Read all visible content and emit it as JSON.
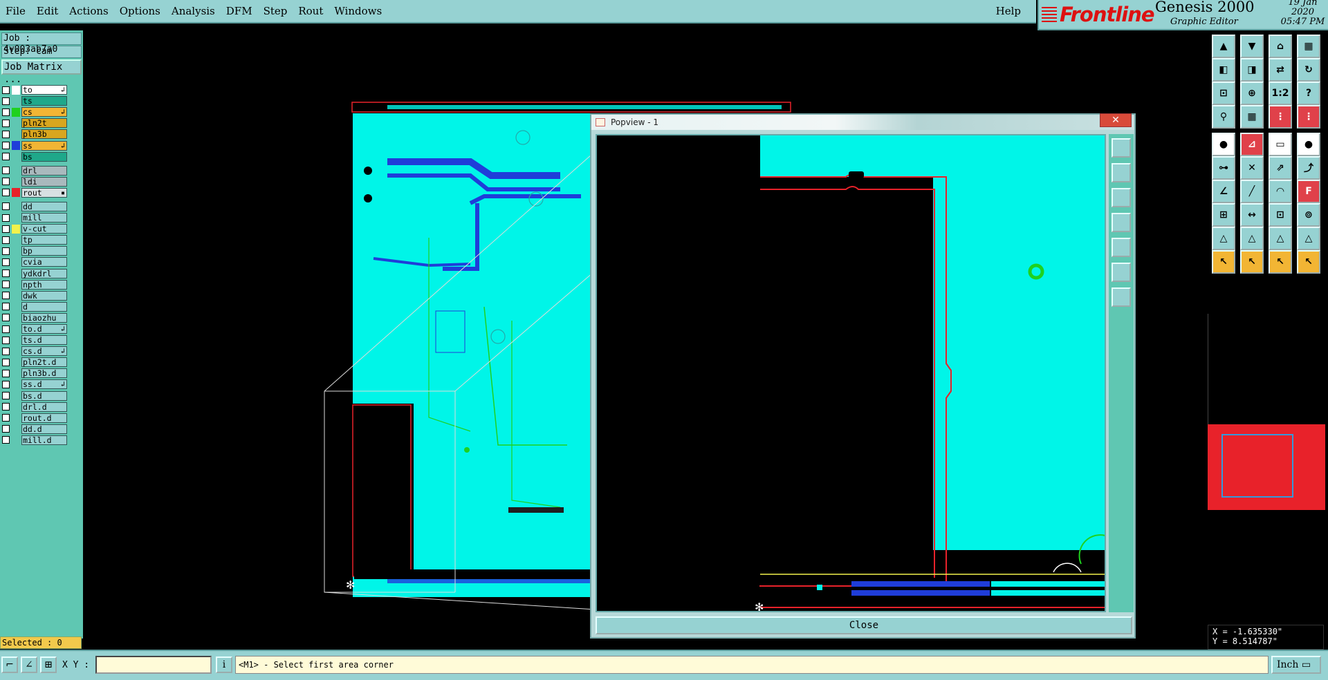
{
  "menu": {
    "items": [
      {
        "label": "File"
      },
      {
        "label": "Edit"
      },
      {
        "label": "Actions"
      },
      {
        "label": "Options"
      },
      {
        "label": "Analysis"
      },
      {
        "label": "DFM"
      },
      {
        "label": "Step"
      },
      {
        "label": "Rout"
      },
      {
        "label": "Windows"
      }
    ],
    "help": "Help"
  },
  "brand": {
    "logo": "Frontline",
    "product": "Genesis 2000",
    "subtitle": "Graphic Editor",
    "date": "19 Jan 2020",
    "time": "05:47 PM",
    "logo_color": "#dd1111"
  },
  "job": {
    "job_label": "Job : 4v003ab7a0",
    "step_label": "Step: cam",
    "matrix_button": "Job Matrix ..."
  },
  "layers": {
    "group1": [
      {
        "name": "to",
        "color": "#ffffff",
        "bg": "#ffffff",
        "mark": "↲"
      },
      {
        "name": "ts",
        "color": "",
        "bg": "#1fa88a",
        "mark": ""
      },
      {
        "name": "cs",
        "color": "#1fd11f",
        "bg": "#f2b534",
        "mark": "↲"
      },
      {
        "name": "pln2t",
        "color": "",
        "bg": "#d9a61f",
        "mark": ""
      },
      {
        "name": "pln3b",
        "color": "",
        "bg": "#d9a61f",
        "mark": ""
      },
      {
        "name": "ss",
        "color": "#1f3dd9",
        "bg": "#f2b534",
        "mark": "↲"
      },
      {
        "name": "bs",
        "color": "",
        "bg": "#1fa88a",
        "mark": ""
      }
    ],
    "group2": [
      {
        "name": "drl",
        "color": "",
        "bg": "#a9b9bd",
        "mark": ""
      },
      {
        "name": "ldi",
        "color": "",
        "bg": "#a9b9bd",
        "mark": ""
      },
      {
        "name": "rout",
        "color": "#e8222a",
        "bg": "#d8e0e2",
        "mark": "▪"
      }
    ],
    "group3": [
      {
        "name": "dd",
        "color": "",
        "bg": "#96d2d2",
        "mark": ""
      },
      {
        "name": "mill",
        "color": "",
        "bg": "#96d2d2",
        "mark": ""
      },
      {
        "name": "v-cut",
        "color": "#f2f24c",
        "bg": "#96d2d2",
        "mark": ""
      },
      {
        "name": "tp",
        "color": "",
        "bg": "#96d2d2",
        "mark": ""
      },
      {
        "name": "bp",
        "color": "",
        "bg": "#96d2d2",
        "mark": ""
      },
      {
        "name": "cvia",
        "color": "",
        "bg": "#96d2d2",
        "mark": ""
      },
      {
        "name": "ydkdrl",
        "color": "",
        "bg": "#96d2d2",
        "mark": ""
      },
      {
        "name": "npth",
        "color": "",
        "bg": "#96d2d2",
        "mark": ""
      },
      {
        "name": "dwk",
        "color": "",
        "bg": "#96d2d2",
        "mark": ""
      },
      {
        "name": "d",
        "color": "",
        "bg": "#96d2d2",
        "mark": ""
      },
      {
        "name": "biaozhu",
        "color": "",
        "bg": "#96d2d2",
        "mark": ""
      },
      {
        "name": "to.d",
        "color": "",
        "bg": "#96d2d2",
        "mark": "↲"
      },
      {
        "name": "ts.d",
        "color": "",
        "bg": "#96d2d2",
        "mark": ""
      },
      {
        "name": "cs.d",
        "color": "",
        "bg": "#96d2d2",
        "mark": "↲"
      },
      {
        "name": "pln2t.d",
        "color": "",
        "bg": "#96d2d2",
        "mark": ""
      },
      {
        "name": "pln3b.d",
        "color": "",
        "bg": "#96d2d2",
        "mark": ""
      },
      {
        "name": "ss.d",
        "color": "",
        "bg": "#96d2d2",
        "mark": "↲"
      },
      {
        "name": "bs.d",
        "color": "",
        "bg": "#96d2d2",
        "mark": ""
      },
      {
        "name": "drl.d",
        "color": "",
        "bg": "#96d2d2",
        "mark": ""
      },
      {
        "name": "rout.d",
        "color": "",
        "bg": "#96d2d2",
        "mark": ""
      },
      {
        "name": "dd.d",
        "color": "",
        "bg": "#96d2d2",
        "mark": ""
      },
      {
        "name": "mill.d",
        "color": "",
        "bg": "#96d2d2",
        "mark": ""
      }
    ]
  },
  "selected": "Selected : 0",
  "popview": {
    "title": "Popview - 1",
    "close_label": "Close"
  },
  "coords": {
    "x": "X = -1.635330\"",
    "y": "Y = 8.514787\""
  },
  "bottom": {
    "xy_label": "X Y :",
    "xy_value": "",
    "prompt": "<M1> - Select first area corner",
    "unit": "Inch"
  },
  "colors": {
    "panel": "#96d2d2",
    "copper": "#00f5e8",
    "rout": "#e8222a",
    "trace": "#1f3dd9"
  }
}
